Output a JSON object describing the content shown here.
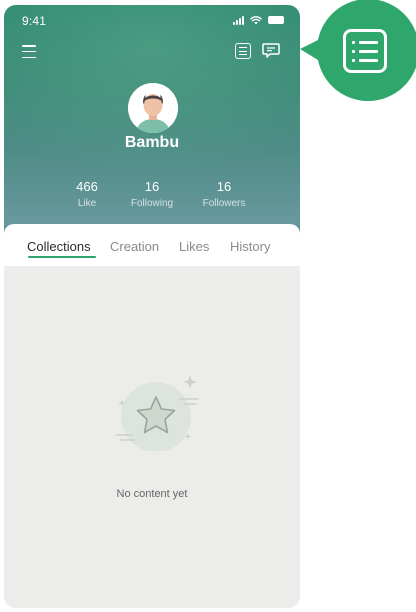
{
  "status_bar": {
    "time": "9:41"
  },
  "header": {
    "menu_icon": "hamburger-menu-icon",
    "list_icon": "list-icon",
    "message_icon": "message-icon"
  },
  "profile": {
    "username": "Bambu",
    "stats": [
      {
        "value": "466",
        "label": "Like"
      },
      {
        "value": "16",
        "label": "Following"
      },
      {
        "value": "16",
        "label": "Followers"
      }
    ]
  },
  "tabs": [
    {
      "label": "Collections",
      "active": true
    },
    {
      "label": "Creation",
      "active": false
    },
    {
      "label": "Likes",
      "active": false
    },
    {
      "label": "History",
      "active": false
    }
  ],
  "content": {
    "empty_message": "No content yet",
    "empty_icon": "star-icon"
  },
  "callout": {
    "icon": "list-icon",
    "color": "#2fa66c"
  },
  "colors": {
    "accent": "#2fa66c",
    "header_top": "#2f8a71",
    "header_bottom": "#6b9aa2",
    "background": "#ececea"
  }
}
